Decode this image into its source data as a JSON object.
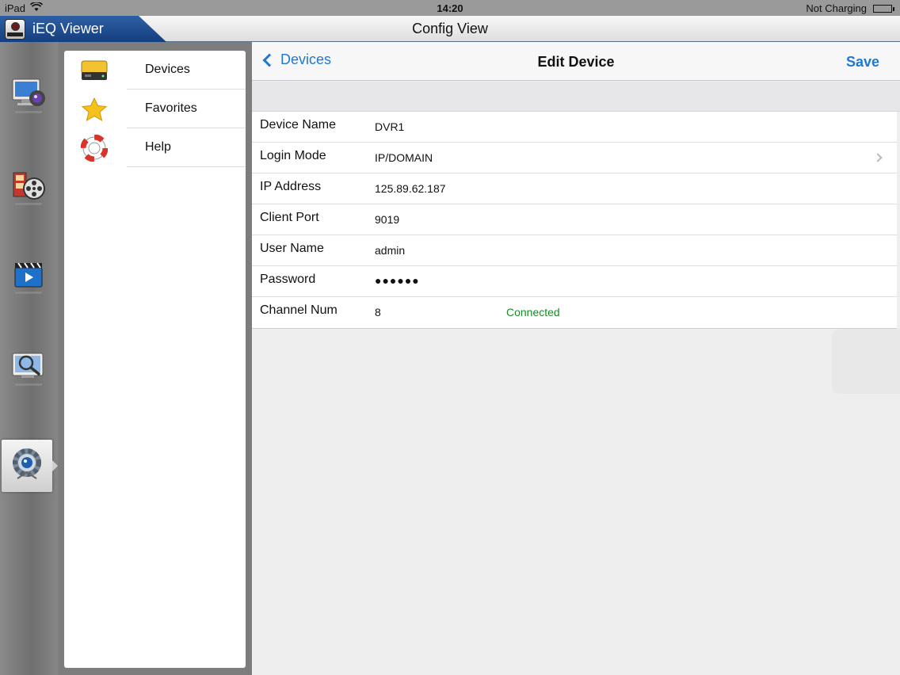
{
  "status_bar": {
    "device": "iPad",
    "time": "14:20",
    "charge_status": "Not Charging"
  },
  "app": {
    "name": "iEQ Viewer",
    "view_title": "Config View"
  },
  "dock": {
    "items": [
      {
        "icon": "monitor-camera-icon",
        "active": false
      },
      {
        "icon": "film-reel-icon",
        "active": false
      },
      {
        "icon": "clapperboard-icon",
        "active": false
      },
      {
        "icon": "search-monitor-icon",
        "active": false
      },
      {
        "icon": "gear-config-icon",
        "active": true
      }
    ]
  },
  "menu": {
    "items": [
      {
        "label": "Devices",
        "icon": "dvr-device-icon"
      },
      {
        "label": "Favorites",
        "icon": "star-icon"
      },
      {
        "label": "Help",
        "icon": "lifebuoy-icon"
      }
    ]
  },
  "edit_device": {
    "back_label": "Devices",
    "title": "Edit Device",
    "save_label": "Save",
    "fields": [
      {
        "label": "Device Name",
        "value": "DVR1"
      },
      {
        "label": "Login Mode",
        "value": "IP/DOMAIN"
      },
      {
        "label": "IP Address",
        "value": "125.89.62.187"
      },
      {
        "label": "Client Port",
        "value": "9019"
      },
      {
        "label": "User Name",
        "value": "admin"
      },
      {
        "label": "Password",
        "value": "●●●●●●"
      },
      {
        "label": "Channel Num",
        "value": "8"
      }
    ],
    "connection_status": "Connected"
  },
  "colors": {
    "accent": "#1f78d1",
    "connected": "#1a8a2a",
    "app_badge": "#1d4a8e"
  }
}
